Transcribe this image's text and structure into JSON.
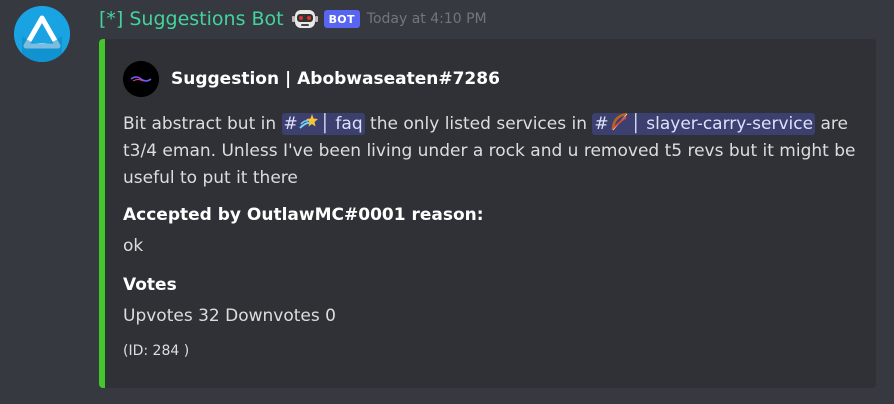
{
  "message": {
    "author": "[*] Suggestions Bot",
    "author_emoji": "robot-face-emoji",
    "bot_tag": "BOT",
    "timestamp": "Today at 4:10 PM"
  },
  "embed": {
    "accent_color": "#44c72b",
    "author_name": "Suggestion | Abobwaseaten#7286",
    "description": {
      "part1": "Bit abstract but in ",
      "channel1": {
        "hash": "#",
        "emoji": "dizzy-star-emoji",
        "name": "│ faq"
      },
      "part2": " the only listed services in ",
      "channel2": {
        "hash": "#",
        "emoji": "bow-and-arrow-emoji",
        "name": "│ slayer-carry-service"
      },
      "part3": " are t3/4 eman. Unless I've been living under a rock and u removed t5 revs but it might be useful to put it there"
    },
    "fields": [
      {
        "name": "Accepted by OutlawMC#0001 reason:",
        "value": "ok"
      },
      {
        "name": "Votes",
        "value": "Upvotes 32 Downvotes 0"
      }
    ],
    "footer": "(ID: 284 )"
  },
  "colors": {
    "background": "#36393f",
    "embed_background": "#2f3136",
    "bot_name": "#42d49e",
    "bot_tag": "#5865f2",
    "mention_bg": "#4e5493"
  }
}
